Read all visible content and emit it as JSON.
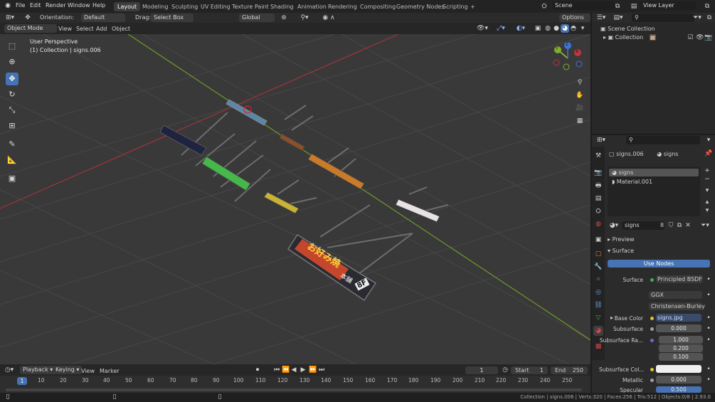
{
  "menubar": {
    "items": [
      "File",
      "Edit",
      "Render",
      "Window",
      "Help"
    ],
    "workspaces": [
      "Layout",
      "Modeling",
      "Sculpting",
      "UV Editing",
      "Texture Paint",
      "Shading",
      "Animation",
      "Rendering",
      "Compositing",
      "Geometry Nodes",
      "Scripting"
    ],
    "active_workspace": "Layout",
    "add_tab": "+",
    "scene_name": "Scene",
    "view_layer_name": "View Layer"
  },
  "viewport_header": {
    "orientation_label": "Orientation:",
    "orientation_value": "Default",
    "drag_label": "Drag:",
    "drag_value": "Select Box",
    "transform_orientation": "Global",
    "options_label": "Options",
    "mode": "Object Mode",
    "menus": [
      "View",
      "Select",
      "Add",
      "Object"
    ]
  },
  "viewport": {
    "perspective_label": "User Perspective",
    "collection_label": "(1) Collection | signs.006",
    "gizmo_axes": [
      "X",
      "Y",
      "Z"
    ],
    "sign_text_1": "お好み焼",
    "sign_text_2": "8F",
    "sign_text_3": "本舗"
  },
  "outliner": {
    "search_placeholder": "",
    "scene_collection": "Scene Collection",
    "collection": "Collection"
  },
  "properties": {
    "search_placeholder": "",
    "object_name": "signs.006",
    "material_name": "signs",
    "slots": [
      "signs",
      "Material.001"
    ],
    "material_field": "signs",
    "user_count": "8",
    "sections": {
      "preview": "Preview",
      "surface": "Surface"
    },
    "use_nodes_label": "Use Nodes",
    "rows": [
      {
        "label": "Surface",
        "value": "Principled BSDF",
        "dot": "#3fb24a"
      },
      {
        "label": "",
        "value": "GGX",
        "dot": ""
      },
      {
        "label": "",
        "value": "Christensen-Burley",
        "dot": ""
      },
      {
        "label": "Base Color",
        "value": "signs.jpg",
        "dot": "#d7c43a"
      },
      {
        "label": "Subsurface",
        "value": "0.000",
        "dot": "#a0a0a0"
      },
      {
        "label": "Subsurface Ra...",
        "value": "1.000",
        "dot": "#6b6bd6"
      },
      {
        "label": "",
        "value": "0.200",
        "dot": ""
      },
      {
        "label": "",
        "value": "0.100",
        "dot": ""
      },
      {
        "label": "Subsurface Col...",
        "value": "",
        "dot": "#d7c43a"
      },
      {
        "label": "Metallic",
        "value": "0.000",
        "dot": "#a0a0a0"
      },
      {
        "label": "Specular",
        "value": "0.500",
        "dot": "#a0a0a0"
      }
    ]
  },
  "timeline": {
    "menus": [
      "Playback",
      "Keying",
      "View",
      "Marker"
    ],
    "current_frame": "1",
    "start_label": "Start",
    "start_value": "1",
    "end_label": "End",
    "end_value": "250",
    "ruler": [
      "1",
      "10",
      "20",
      "30",
      "40",
      "50",
      "60",
      "70",
      "80",
      "90",
      "100",
      "110",
      "120",
      "130",
      "140",
      "150",
      "160",
      "170",
      "180",
      "190",
      "200",
      "210",
      "220",
      "230",
      "240",
      "250"
    ]
  },
  "statusbar": {
    "text": "Collection | signs.006 | Verts:320 | Faces:256 | Tris:512 | Objects:0/8 | 2.93.0"
  },
  "colors": {
    "accent": "#4772b3",
    "x_axis": "#c0353f",
    "y_axis": "#7fb02d",
    "z_axis": "#3f74d6"
  }
}
